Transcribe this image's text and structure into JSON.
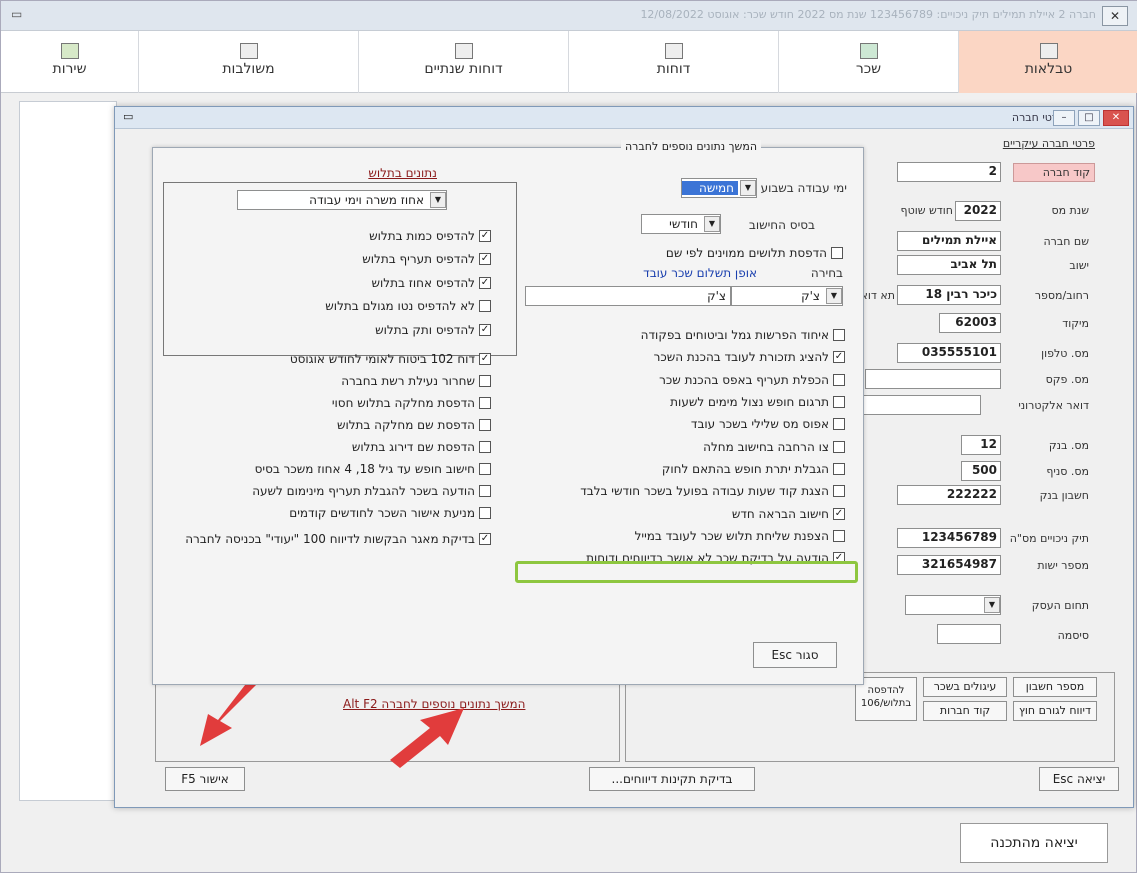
{
  "main": {
    "title": "חברה 2 איילת תמילים  תיק ניכויים: 123456789  שנת מס 2022  חודש שכר: אוגוסט   12/08/2022",
    "toolbar": [
      {
        "label": "טבלאות",
        "icon": "table-icon",
        "active": true
      },
      {
        "label": "שכר",
        "icon": "salary-icon",
        "active": false
      },
      {
        "label": "דוחות",
        "icon": "reports-icon",
        "active": false
      },
      {
        "label": "דוחות שנתיים",
        "icon": "annual-reports-icon",
        "active": false
      },
      {
        "label": "משולבות",
        "icon": "combined-icon",
        "active": false
      },
      {
        "label": "שירות",
        "icon": "service-icon",
        "active": false
      }
    ],
    "exit_program": "יציאה מהתכנה"
  },
  "dialog": {
    "title": "פרטי חברה",
    "section_main": "פרטי חברה עיקריים",
    "fields": {
      "company_code": {
        "label": "קוד חברה",
        "value": "2"
      },
      "tax_year": {
        "label": "שנת מס",
        "value": "2022",
        "extra": "חודש שוטף"
      },
      "company_name": {
        "label": "שם חברה",
        "value": "איילת תמילים"
      },
      "city": {
        "label": "ישוב",
        "value": "תל אביב"
      },
      "street": {
        "label": "רחוב/מספר",
        "value": "כיכר רבין 18",
        "extra": "תא דואר"
      },
      "zip": {
        "label": "מיקוד",
        "value": "62003"
      },
      "phone": {
        "label": "מס. טלפון",
        "value": "035555101"
      },
      "fax": {
        "label": "מס. פקס",
        "value": ""
      },
      "email": {
        "label": "דואר אלקטרוני",
        "value": ""
      },
      "bank": {
        "label": "מס. בנק",
        "value": "12"
      },
      "branch": {
        "label": "מס. סניף",
        "value": "500"
      },
      "account": {
        "label": "חשבון בנק",
        "value": "222222"
      },
      "deductions": {
        "label": "תיק ניכויים מס\"ה",
        "value": "123456789"
      },
      "vat": {
        "label": "מספר ישות",
        "value": "321654987"
      },
      "business_field": {
        "label": "תחום העסק",
        "value": ""
      },
      "password": {
        "label": "סיסמה",
        "value": ""
      }
    },
    "buttons": {
      "account_number": "מספר חשבון",
      "rounding": "עיגולים בשכר",
      "report_external": "דיווח לגורם חוץ",
      "company_code": "קוד חברות",
      "print_106": "להדפסה בתלוש/106",
      "continue_link": "המשך נתונים נוספים לחברה  Alt F2",
      "approve": "אישור F5",
      "check": "בדיקת תקינות דיווחים...",
      "exit": "יציאה Esc"
    }
  },
  "sub": {
    "title": "המשך נתונים נוספים לחברה",
    "payslip_title": "נתונים בתלוש",
    "work_days_label": "ימי עבודה בשבוע",
    "work_days_value": "חמישה",
    "calc_basis_label": "בסיס החישוב",
    "calc_basis_value": "חודשי",
    "print_sorted": "הדפסת תלושים ממוינים לפי שם",
    "choice_label": "בחירה",
    "payment_label": "אופן תשלום שכר עובד",
    "payment_value_right": "צ'ק",
    "payment_value_left": "צ'ק",
    "payslip_select": "אחוז משרה וימי עבודה",
    "payslip_checks": [
      {
        "label": "להדפיס כמות בתלוש",
        "checked": true
      },
      {
        "label": "להדפיס תעריף בתלוש",
        "checked": true
      },
      {
        "label": "להדפיס אחוז בתלוש",
        "checked": true
      },
      {
        "label": "לא להדפיס נטו מגולם בתלוש",
        "checked": false
      },
      {
        "label": "להדפיס ותק בתלוש",
        "checked": true
      }
    ],
    "left_checks": [
      {
        "label": "דוח 102 ביטוח לאומי לחודש אוגוסט",
        "checked": true
      },
      {
        "label": "שחרור נעילת רשת בחברה",
        "checked": false
      },
      {
        "label": "הדפסת מחלקה בתלוש חסוי",
        "checked": false
      },
      {
        "label": "הדפסת שם מחלקה בתלוש",
        "checked": false
      },
      {
        "label": "הדפסת שם דירוג בתלוש",
        "checked": false
      },
      {
        "label": "חישוב חופש עד גיל 18, 4 אחוז משכר בסיס",
        "checked": false
      },
      {
        "label": "הודעה בשכר להגבלת תעריף מינימום לשעה",
        "checked": false
      },
      {
        "label": "מניעת אישור השכר לחודשים קודמים",
        "checked": false
      },
      {
        "label": "בדיקת מאגר הבקשות לדיווח 100 \"יעודי\" בכניסה לחברה",
        "checked": true
      }
    ],
    "right_checks": [
      {
        "label": "איחוד הפרשות גמל וביטוחים בפקודה",
        "checked": false
      },
      {
        "label": "להציג תזכורת לעובד בהכנת השכר",
        "checked": true
      },
      {
        "label": "הכפלת תעריף באפס בהכנת שכר",
        "checked": false
      },
      {
        "label": "תרגום חופש נצול מימים לשעות",
        "checked": false
      },
      {
        "label": "אפוס מס שלילי בשכר עובד",
        "checked": false
      },
      {
        "label": "צו הרחבה בחישוב מחלה",
        "checked": false
      },
      {
        "label": "הגבלת יתרת חופש בהתאם לחוק",
        "checked": false
      },
      {
        "label": "הצגת קוד שעות עבודה בפועל בשכר חודשי בלבד",
        "checked": false
      },
      {
        "label": "חישוב הבראה חדש",
        "checked": true
      },
      {
        "label": "הצפנת שליחת תלוש שכר לעובד במייל",
        "checked": false
      },
      {
        "label": "הודעה על בדיקת שכר לא אושר בדיווחים ודוחות",
        "checked": true
      }
    ],
    "close": "סגור Esc"
  }
}
